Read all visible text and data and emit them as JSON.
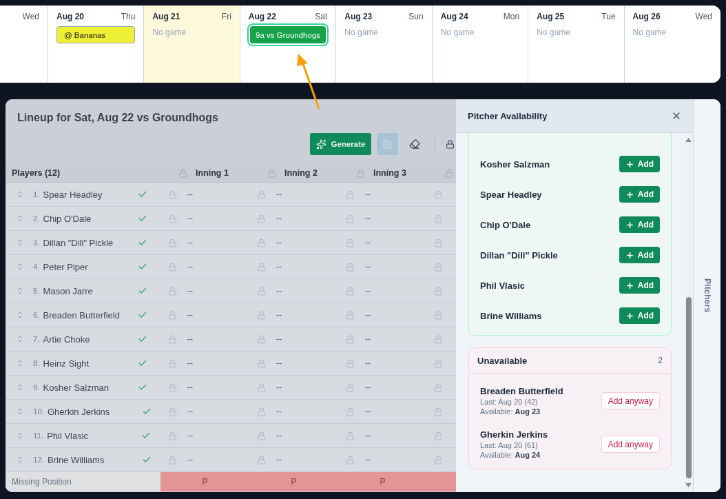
{
  "calendar": {
    "days": [
      {
        "weekday": "Wed",
        "highlighted": false
      },
      {
        "date": "Aug 20",
        "weekday": "Thu",
        "highlighted": false,
        "game": {
          "label": "@ Bananas",
          "kind": "away",
          "selected": false
        }
      },
      {
        "date": "Aug 21",
        "weekday": "Fri",
        "highlighted": true,
        "note": "No game"
      },
      {
        "date": "Aug 22",
        "weekday": "Sat",
        "highlighted": false,
        "game": {
          "label": "9a vs Groundhogs",
          "kind": "home",
          "selected": true
        }
      },
      {
        "date": "Aug 23",
        "weekday": "Sun",
        "highlighted": false,
        "note": "No game"
      },
      {
        "date": "Aug 24",
        "weekday": "Mon",
        "highlighted": false,
        "note": "No game"
      },
      {
        "date": "Aug 25",
        "weekday": "Tue",
        "highlighted": false,
        "note": "No game"
      },
      {
        "date": "Aug 26",
        "weekday": "Wed",
        "highlighted": false,
        "note": "No game"
      }
    ]
  },
  "lineup": {
    "title": "Lineup for Sat, Aug 22 vs Groundhogs",
    "toolbar": {
      "generate": "Generate",
      "save_disabled": true
    },
    "players_heading": "Players (12)",
    "innings": [
      "Inning 1",
      "Inning 2",
      "Inning 3"
    ],
    "players": [
      {
        "number": "1.",
        "name": "Spear Headley",
        "checked": true,
        "cells": [
          "--",
          "--",
          "--"
        ]
      },
      {
        "number": "2.",
        "name": "Chip O'Dale",
        "checked": true,
        "cells": [
          "--",
          "--",
          "--"
        ]
      },
      {
        "number": "3.",
        "name": "Dillan \"Dill\" Pickle",
        "checked": true,
        "cells": [
          "--",
          "--",
          "--"
        ]
      },
      {
        "number": "4.",
        "name": "Peter Piper",
        "checked": true,
        "cells": [
          "--",
          "--",
          "--"
        ]
      },
      {
        "number": "5.",
        "name": "Mason Jarre",
        "checked": true,
        "cells": [
          "--",
          "--",
          "--"
        ]
      },
      {
        "number": "6.",
        "name": "Breaden Butterfield",
        "checked": true,
        "cells": [
          "--",
          "--",
          "--"
        ]
      },
      {
        "number": "7.",
        "name": "Artie Choke",
        "checked": true,
        "cells": [
          "--",
          "--",
          "--"
        ]
      },
      {
        "number": "8.",
        "name": "Heinz Sight",
        "checked": true,
        "cells": [
          "--",
          "--",
          "--"
        ]
      },
      {
        "number": "9.",
        "name": "Kosher Salzman",
        "checked": true,
        "cells": [
          "--",
          "--",
          "--"
        ]
      },
      {
        "number": "10.",
        "name": "Gherkin Jerkins",
        "checked": true,
        "cells": [
          "--",
          "--",
          "--"
        ]
      },
      {
        "number": "11.",
        "name": "Phil Vlasic",
        "checked": true,
        "cells": [
          "--",
          "--",
          "--"
        ]
      },
      {
        "number": "12.",
        "name": "Brine Williams",
        "checked": true,
        "cells": [
          "--",
          "--",
          "--"
        ]
      }
    ],
    "footer": {
      "label": "Missing Position",
      "cells": [
        "P",
        "P",
        "P"
      ]
    }
  },
  "drawer": {
    "title": "Pitcher Availability",
    "available": [
      {
        "name": "Kosher Salzman",
        "action": "Add"
      },
      {
        "name": "Spear Headley",
        "action": "Add"
      },
      {
        "name": "Chip O'Dale",
        "action": "Add"
      },
      {
        "name": "Dillan \"Dill\" Pickle",
        "action": "Add"
      },
      {
        "name": "Phil Vlasic",
        "action": "Add"
      },
      {
        "name": "Brine Williams",
        "action": "Add"
      }
    ],
    "unavailable": {
      "title": "Unavailable",
      "count": "2",
      "players": [
        {
          "name": "Breaden Butterfield",
          "last": "Last: Aug 20 (42)",
          "available": "Available: **Aug 23**",
          "action": "Add anyway"
        },
        {
          "name": "Gherkin Jerkins",
          "last": "Last: Aug 20 (61)",
          "available": "Available: **Aug 24**",
          "action": "Add anyway"
        }
      ]
    }
  },
  "side_tab": "Pitchers"
}
